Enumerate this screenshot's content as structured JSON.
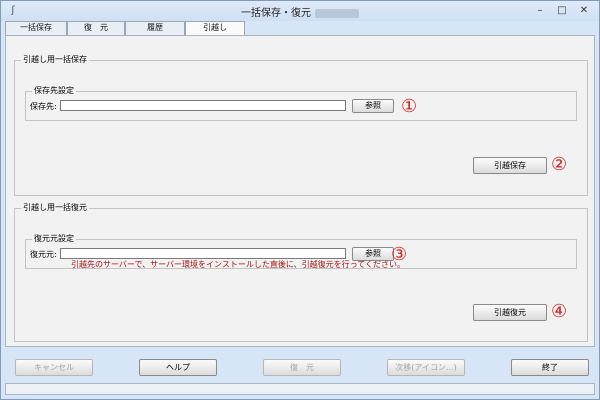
{
  "window": {
    "title": "一括保存・復元",
    "app_icon": "app-icon"
  },
  "title_controls": {
    "minimize": "–",
    "maximize": "□",
    "close": "✕"
  },
  "tabs": [
    {
      "label": "一括保存",
      "active": false
    },
    {
      "label": "復　元",
      "active": false
    },
    {
      "label": "履歴",
      "active": false
    },
    {
      "label": "引越し",
      "active": true
    }
  ],
  "save_section": {
    "title": "引越し用一括保存",
    "destination_group_title": "保存先設定",
    "field_label": "保存先:",
    "field_value": "",
    "browse_label": "参照",
    "browse_marker": "①",
    "save_button_label": "引越保存",
    "save_marker": "②"
  },
  "restore_section": {
    "title": "引越し用一括復元",
    "source_group_title": "復元元設定",
    "field_label": "復元元:",
    "field_value": "",
    "browse_label": "参照",
    "browse_marker": "③",
    "notice": "引越先のサーバーで、サーバー環境をインストールした直後に、引越復元を行ってください。",
    "restore_button_label": "引越復元",
    "restore_marker": "④"
  },
  "bottom_buttons": {
    "cancel": {
      "label": "キャンセル",
      "enabled": false
    },
    "help": {
      "label": "ヘルプ",
      "enabled": true
    },
    "restore": {
      "label": "復　元",
      "enabled": false
    },
    "next": {
      "label": "次移(アイコン...)",
      "enabled": false
    },
    "exit": {
      "label": "終了",
      "enabled": true
    }
  },
  "colors": {
    "marker": "#d92020",
    "notice": "#a51010",
    "window_frame": "#d6e6f7"
  }
}
